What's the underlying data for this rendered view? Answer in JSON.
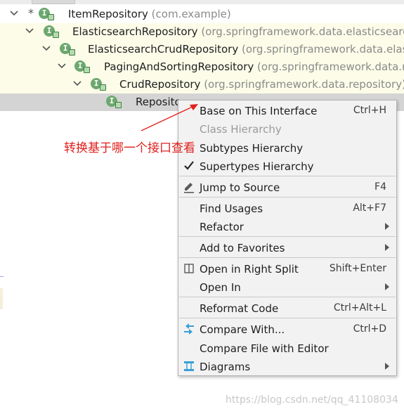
{
  "tree": {
    "rows": [
      {
        "name": "ItemRepository",
        "pkg": " (com.example)"
      },
      {
        "name": "ElasticsearchRepository",
        "pkg": " (org.springframework.data.elasticsearch."
      },
      {
        "name": "ElasticsearchCrudRepository",
        "pkg": " (org.springframework.data.elastic"
      },
      {
        "name": "PagingAndSortingRepository",
        "pkg": " (org.springframework.data.re"
      },
      {
        "name": "CrudRepository",
        "pkg": " (org.springframework.data.repository)"
      },
      {
        "name": "Reposito",
        "pkg": ""
      }
    ],
    "badge_letter": "I"
  },
  "context_menu": {
    "items": [
      {
        "label": "Base on This Interface",
        "shortcut": "Ctrl+H"
      },
      {
        "label": "Class Hierarchy",
        "shortcut": ""
      },
      {
        "label": "Subtypes Hierarchy",
        "shortcut": ""
      },
      {
        "label": "Supertypes Hierarchy",
        "shortcut": ""
      },
      {
        "label": "Jump to Source",
        "shortcut": "F4"
      },
      {
        "label": "Find Usages",
        "shortcut": "Alt+F7"
      },
      {
        "label": "Refactor",
        "shortcut": ""
      },
      {
        "label": "Add to Favorites",
        "shortcut": ""
      },
      {
        "label": "Open in Right Split",
        "shortcut": "Shift+Enter"
      },
      {
        "label": "Open In",
        "shortcut": ""
      },
      {
        "label": "Reformat Code",
        "shortcut": "Ctrl+Alt+L"
      },
      {
        "label": "Compare With...",
        "shortcut": "Ctrl+D"
      },
      {
        "label": "Compare File with Editor",
        "shortcut": ""
      },
      {
        "label": "Diagrams",
        "shortcut": ""
      }
    ]
  },
  "annotation": {
    "text": "转换基于哪一个接口查看"
  },
  "watermark": {
    "text": "https://blog.csdn.net/qq_41108034"
  },
  "colors": {
    "accent_annotation": "#e0201c",
    "interface_badge": "#6ca86f",
    "selection": "#d4d4d4",
    "row_highlight": "#fcfce9",
    "menu_bg": "#f2f2f2"
  }
}
